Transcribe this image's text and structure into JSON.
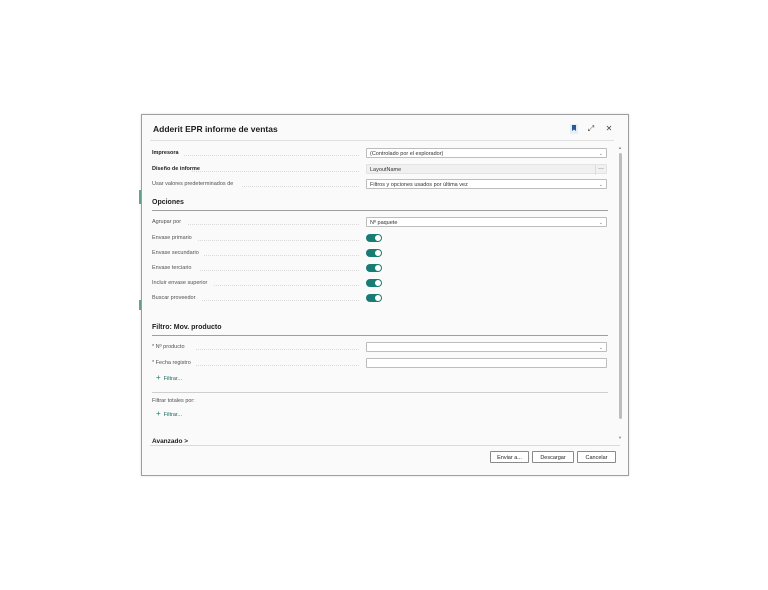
{
  "dialog": {
    "title": "Adderit EPR informe de ventas",
    "icons": [
      "bookmark-icon",
      "expand-icon",
      "close-icon"
    ]
  },
  "general": {
    "printer_label": "Impresora",
    "printer_value": "(Controlado por el explorador)",
    "layout_label": "Diseño de informe",
    "layout_value": "LayoutName",
    "defaults_label": "Usar valores predeterminados de",
    "defaults_value": "Filtros y opciones usados por última vez"
  },
  "options": {
    "title": "Opciones",
    "group_by_label": "Agrupar por",
    "group_by_value": "Nº paquete",
    "toggles": [
      {
        "label": "Envase primario",
        "value": true
      },
      {
        "label": "Envase secundario",
        "value": true
      },
      {
        "label": "Envase terciario",
        "value": true
      },
      {
        "label": "Incluir envase superior",
        "value": true
      },
      {
        "label": "Buscar proveedor",
        "value": true
      }
    ]
  },
  "filter": {
    "title": "Filtro: Mov. producto",
    "product_label": "* Nº producto",
    "product_value": "",
    "date_label": "* Fecha registro",
    "date_value": "",
    "add_filter": "Filtrar...",
    "totals_label": "Filtrar totales por:",
    "totals_add_filter": "Filtrar..."
  },
  "advanced": {
    "label": "Avanzado >"
  },
  "footer": {
    "send_to": "Enviar a...",
    "download": "Descargar",
    "cancel": "Cancelar"
  },
  "colors": {
    "accent": "#197c74",
    "link": "#16695e"
  }
}
